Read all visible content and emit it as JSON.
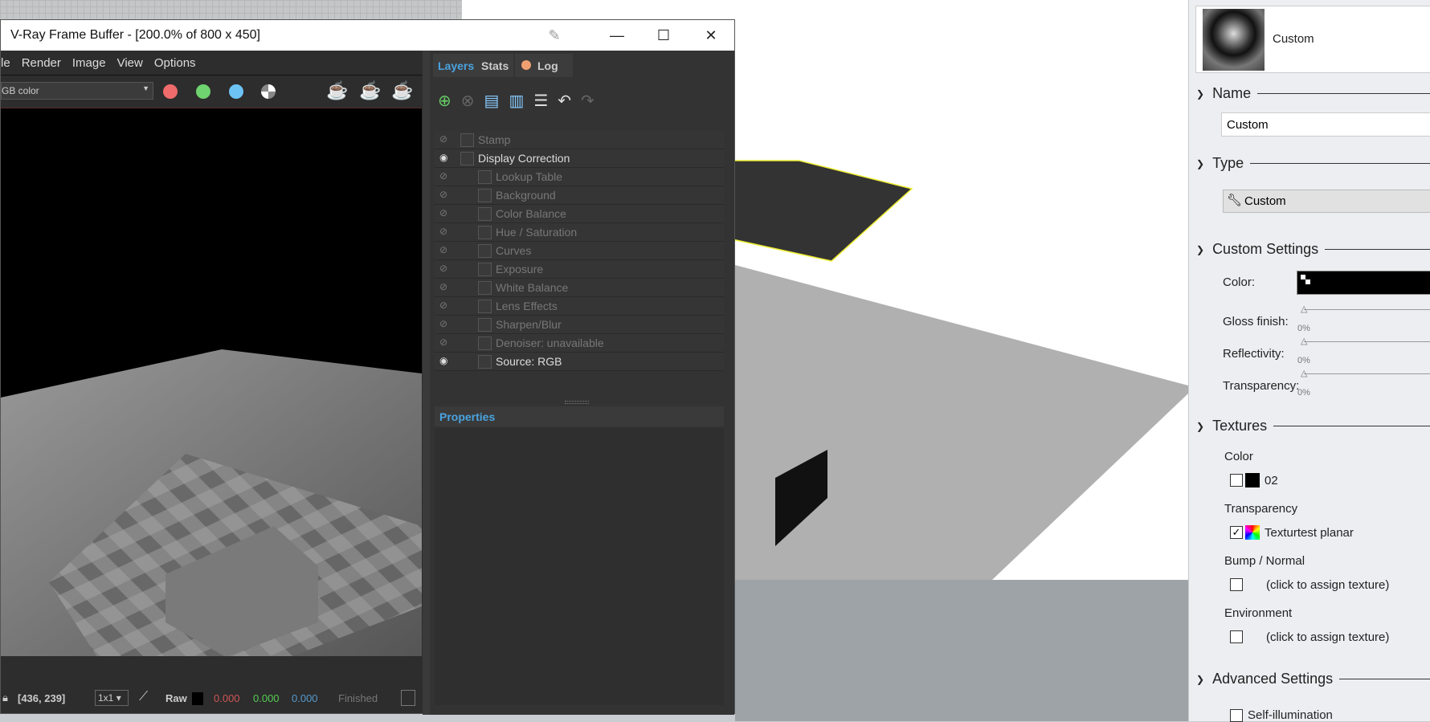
{
  "vfb": {
    "title": "V-Ray Frame Buffer - [200.0% of 800 x 450]",
    "menu": [
      "le",
      "Render",
      "Image",
      "View",
      "Options"
    ],
    "channel_select": "GB color",
    "channel_dots": {
      "red": "#f06b6b",
      "green": "#6fd36f",
      "blue": "#6ec3f5"
    },
    "tabs": [
      "Layers",
      "Stats",
      "Log"
    ],
    "log_dot_color": "#f0a070",
    "layers": [
      {
        "label": "Stamp",
        "visible": false,
        "indent": 0
      },
      {
        "label": "Display Correction",
        "visible": true,
        "indent": 0
      },
      {
        "label": "Lookup Table",
        "visible": false,
        "indent": 1
      },
      {
        "label": "Background",
        "visible": false,
        "indent": 1
      },
      {
        "label": "Color Balance",
        "visible": false,
        "indent": 1
      },
      {
        "label": "Hue / Saturation",
        "visible": false,
        "indent": 1
      },
      {
        "label": "Curves",
        "visible": false,
        "indent": 1
      },
      {
        "label": "Exposure",
        "visible": false,
        "indent": 1
      },
      {
        "label": "White Balance",
        "visible": false,
        "indent": 1
      },
      {
        "label": "Lens Effects",
        "visible": false,
        "indent": 1
      },
      {
        "label": "Sharpen/Blur",
        "visible": false,
        "indent": 1
      },
      {
        "label": "Denoiser: unavailable",
        "visible": false,
        "indent": 1
      },
      {
        "label": "Source: RGB",
        "visible": true,
        "indent": 1
      }
    ],
    "properties_label": "Properties",
    "status": {
      "coords": "[436, 239]",
      "sampling": "1x1",
      "mode": "Raw",
      "r": "0.000",
      "g": "0.000",
      "b": "0.000",
      "state": "Finished"
    }
  },
  "material": {
    "preview_name": "Custom",
    "name_header": "Name",
    "name_value": "Custom",
    "type_header": "Type",
    "type_value": "Custom",
    "custom_header": "Custom Settings",
    "color_label": "Color:",
    "gloss_label": "Gloss finish:",
    "gloss": "0%",
    "reflect_label": "Reflectivity:",
    "reflect": "0%",
    "transp_label": "Transparency:",
    "transp": "0%",
    "textures_header": "Textures",
    "tex_color_label": "Color",
    "tex_color_value": "02",
    "tex_color_checked": false,
    "tex_transp_label": "Transparency",
    "tex_transp_value": "Texturtest planar",
    "tex_transp_checked": true,
    "bump_label": "Bump / Normal",
    "bump_value": "(click to assign texture)",
    "env_label": "Environment",
    "env_value": "(click to assign texture)",
    "advanced_header": "Advanced Settings",
    "self_illum": "Self-illumination"
  }
}
